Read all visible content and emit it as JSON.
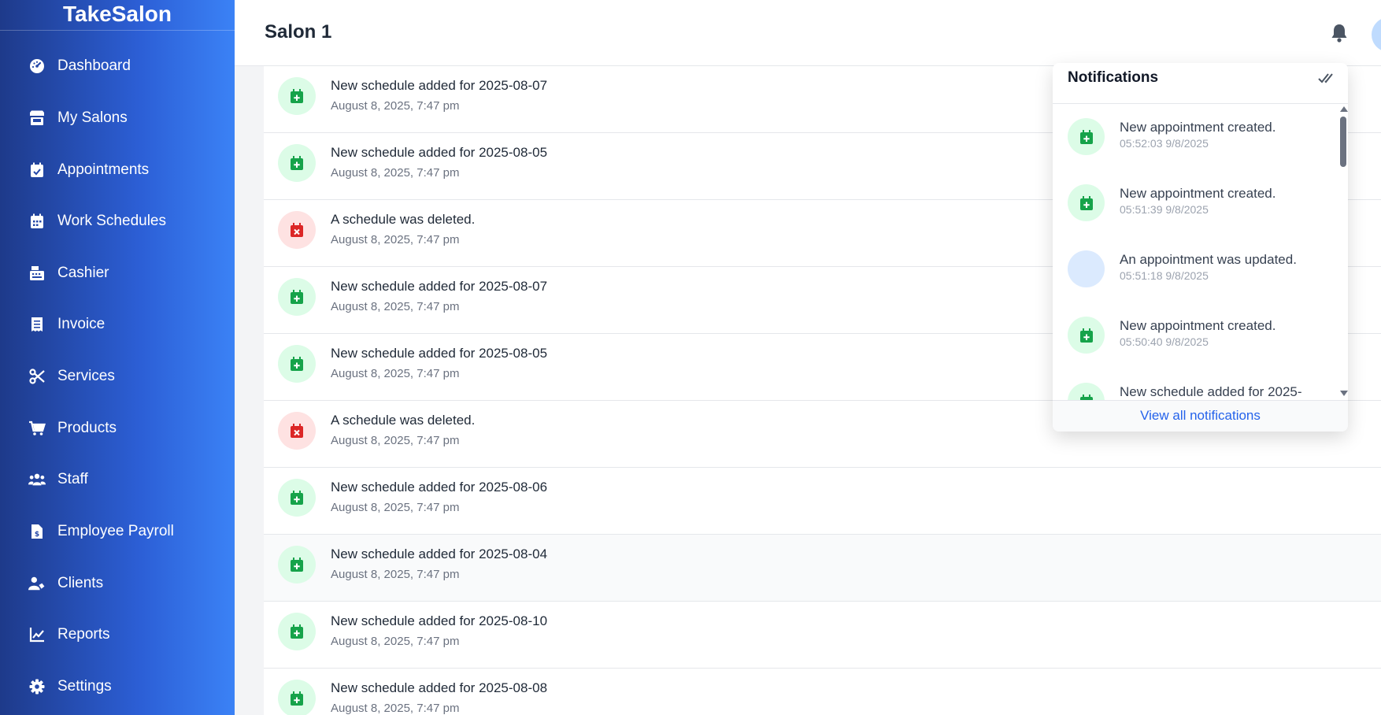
{
  "app": {
    "brand": "TakeSalon"
  },
  "colors": {
    "accent": "#2563eb",
    "success": "#16a34a",
    "danger": "#dc2626"
  },
  "sidebar": {
    "items": [
      {
        "label": "Dashboard",
        "icon": "gauge-icon"
      },
      {
        "label": "My Salons",
        "icon": "store-icon"
      },
      {
        "label": "Appointments",
        "icon": "calendar-check-icon"
      },
      {
        "label": "Work Schedules",
        "icon": "calendar-grid-icon"
      },
      {
        "label": "Cashier",
        "icon": "cash-register-icon"
      },
      {
        "label": "Invoice",
        "icon": "receipt-icon"
      },
      {
        "label": "Services",
        "icon": "scissors-icon"
      },
      {
        "label": "Products",
        "icon": "cart-icon"
      },
      {
        "label": "Staff",
        "icon": "users-icon"
      },
      {
        "label": "Employee Payroll",
        "icon": "payroll-file-icon"
      },
      {
        "label": "Clients",
        "icon": "user-tag-icon"
      },
      {
        "label": "Reports",
        "icon": "line-chart-icon"
      },
      {
        "label": "Settings",
        "icon": "gear-icon"
      }
    ]
  },
  "header": {
    "title": "Salon 1"
  },
  "activity": {
    "rows": [
      {
        "message": "New schedule added for 2025-08-07",
        "time": "August 8, 2025, 7:47 pm",
        "type": "added"
      },
      {
        "message": "New schedule added for 2025-08-05",
        "time": "August 8, 2025, 7:47 pm",
        "type": "added"
      },
      {
        "message": "A schedule was deleted.",
        "time": "August 8, 2025, 7:47 pm",
        "type": "deleted"
      },
      {
        "message": "New schedule added for 2025-08-07",
        "time": "August 8, 2025, 7:47 pm",
        "type": "added"
      },
      {
        "message": "New schedule added for 2025-08-05",
        "time": "August 8, 2025, 7:47 pm",
        "type": "added"
      },
      {
        "message": "A schedule was deleted.",
        "time": "August 8, 2025, 7:47 pm",
        "type": "deleted"
      },
      {
        "message": "New schedule added for 2025-08-06",
        "time": "August 8, 2025, 7:47 pm",
        "type": "added"
      },
      {
        "message": "New schedule added for 2025-08-04",
        "time": "August 8, 2025, 7:47 pm",
        "type": "added"
      },
      {
        "message": "New schedule added for 2025-08-10",
        "time": "August 8, 2025, 7:47 pm",
        "type": "added"
      },
      {
        "message": "New schedule added for 2025-08-08",
        "time": "August 8, 2025, 7:47 pm",
        "type": "added"
      }
    ]
  },
  "notifications": {
    "title": "Notifications",
    "view_all": "View all notifications",
    "items": [
      {
        "message": "New appointment created.",
        "time": "05:52:03 9/8/2025",
        "type": "added"
      },
      {
        "message": "New appointment created.",
        "time": "05:51:39 9/8/2025",
        "type": "added"
      },
      {
        "message": "An appointment was updated.",
        "time": "05:51:18 9/8/2025",
        "type": "updated"
      },
      {
        "message": "New appointment created.",
        "time": "05:50:40 9/8/2025",
        "type": "added"
      },
      {
        "message": "New schedule added for 2025-",
        "time": "",
        "type": "added"
      }
    ]
  }
}
